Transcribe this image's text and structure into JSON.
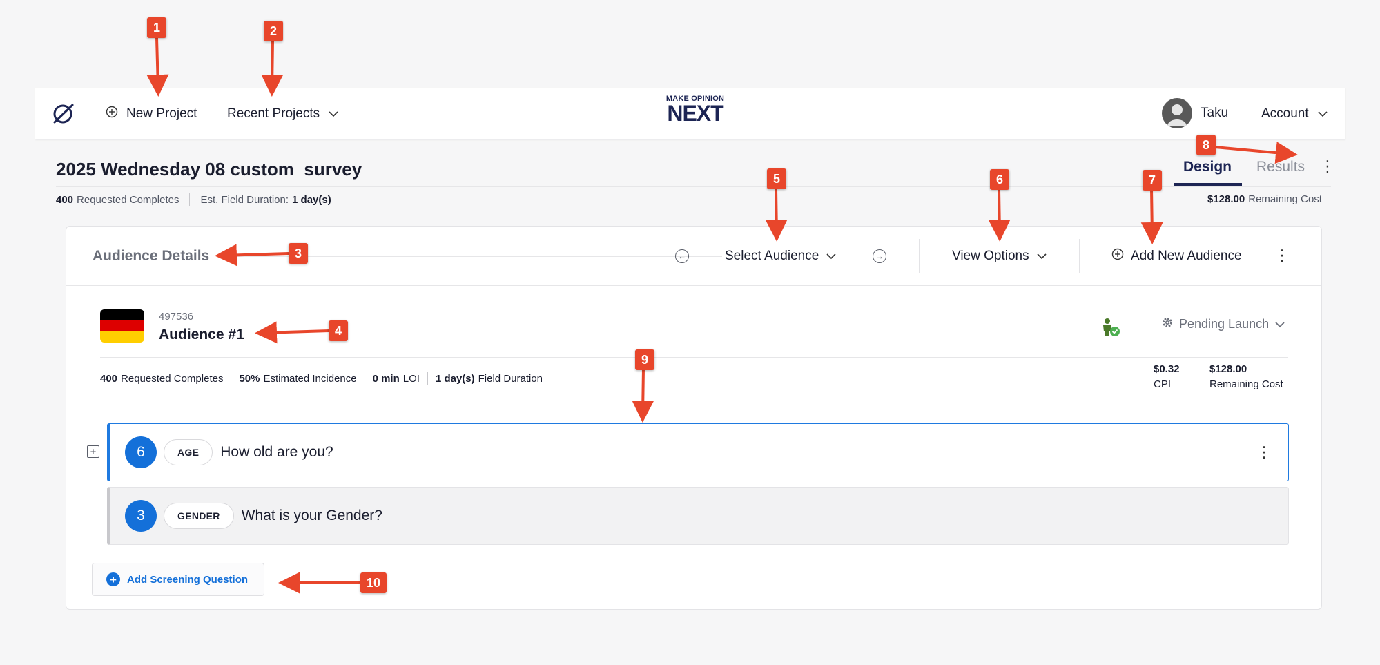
{
  "navbar": {
    "new_project": "New Project",
    "recent_projects": "Recent Projects",
    "brand_small": "MAKE OPINION",
    "brand_big": "NEXT",
    "user_name": "Taku",
    "account": "Account"
  },
  "project": {
    "title": "2025 Wednesday 08 custom_survey",
    "requested_completes_value": "400",
    "requested_completes_label": "Requested Completes",
    "field_duration_label": "Est. Field Duration:",
    "field_duration_value": "1 day(s)",
    "remaining_cost_value": "$128.00",
    "remaining_cost_label": "Remaining Cost"
  },
  "tabs": {
    "design": "Design",
    "results": "Results"
  },
  "audience_header": {
    "title": "Audience Details",
    "select_audience": "Select Audience",
    "view_options": "View Options",
    "add_new_audience": "Add New Audience"
  },
  "audience": {
    "id": "497536",
    "name": "Audience #1",
    "status": "Pending Launch",
    "requested_completes_value": "400",
    "requested_completes_label": "Requested Completes",
    "incidence_value": "50%",
    "incidence_label": "Estimated Incidence",
    "loi_value": "0 min",
    "loi_label": "LOI",
    "duration_value": "1 day(s)",
    "duration_label": "Field Duration",
    "cpi_value": "$0.32",
    "cpi_label": "CPI",
    "remaining_cost_value": "$128.00",
    "remaining_cost_label": "Remaining Cost"
  },
  "questions": [
    {
      "count": "6",
      "tag": "AGE",
      "text": "How old are you?"
    },
    {
      "count": "3",
      "tag": "GENDER",
      "text": "What is your Gender?"
    }
  ],
  "add_screening_question": "Add Screening Question",
  "markers": [
    "1",
    "2",
    "3",
    "4",
    "5",
    "6",
    "7",
    "8",
    "9",
    "10"
  ],
  "colors": {
    "accent": "#1470d9",
    "navy": "#1d2554",
    "marker": "#e8462b",
    "flag_black": "#000000",
    "flag_red": "#dd0000",
    "flag_gold": "#ffce00"
  }
}
